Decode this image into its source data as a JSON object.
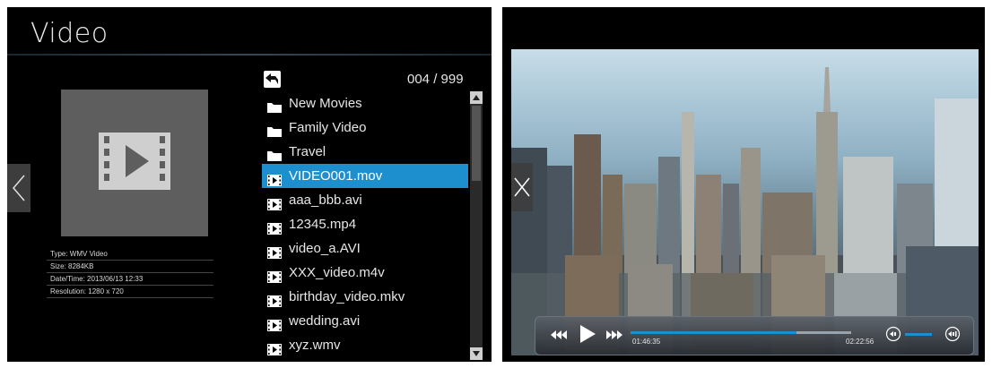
{
  "browser": {
    "title": "Video",
    "counter": "004 / 999",
    "items": [
      {
        "label": "New Movies",
        "type": "folder"
      },
      {
        "label": "Family Video",
        "type": "folder"
      },
      {
        "label": "Travel",
        "type": "folder"
      },
      {
        "label": "VIDEO001.mov",
        "type": "video",
        "selected": true
      },
      {
        "label": "aaa_bbb.avi",
        "type": "video"
      },
      {
        "label": "12345.mp4",
        "type": "video"
      },
      {
        "label": "video_a.AVI",
        "type": "video"
      },
      {
        "label": "XXX_video.m4v",
        "type": "video"
      },
      {
        "label": "birthday_video.mkv",
        "type": "video"
      },
      {
        "label": "wedding.avi",
        "type": "video"
      },
      {
        "label": "xyz.wmv",
        "type": "video"
      }
    ],
    "info": [
      "Type: WMV Video",
      "Size: 8284KB",
      "Date/Time: 2013/06/13 12:33",
      "Resolution: 1280 x 720"
    ]
  },
  "player": {
    "elapsed": "01:46:35",
    "total": "02:22:56",
    "progress": 0.75,
    "volume": 0.6
  },
  "colors": {
    "accent": "#1e8fce",
    "background": "#000000"
  },
  "icons": {
    "back": "chevron-left-icon",
    "up": "return-arrow-icon",
    "folder": "folder-icon",
    "video": "film-icon",
    "close": "close-icon",
    "rewind": "rewind-icon",
    "play": "play-icon",
    "fast_forward": "fast-forward-icon",
    "volume_down": "volume-down-icon",
    "volume_up": "volume-up-icon"
  }
}
